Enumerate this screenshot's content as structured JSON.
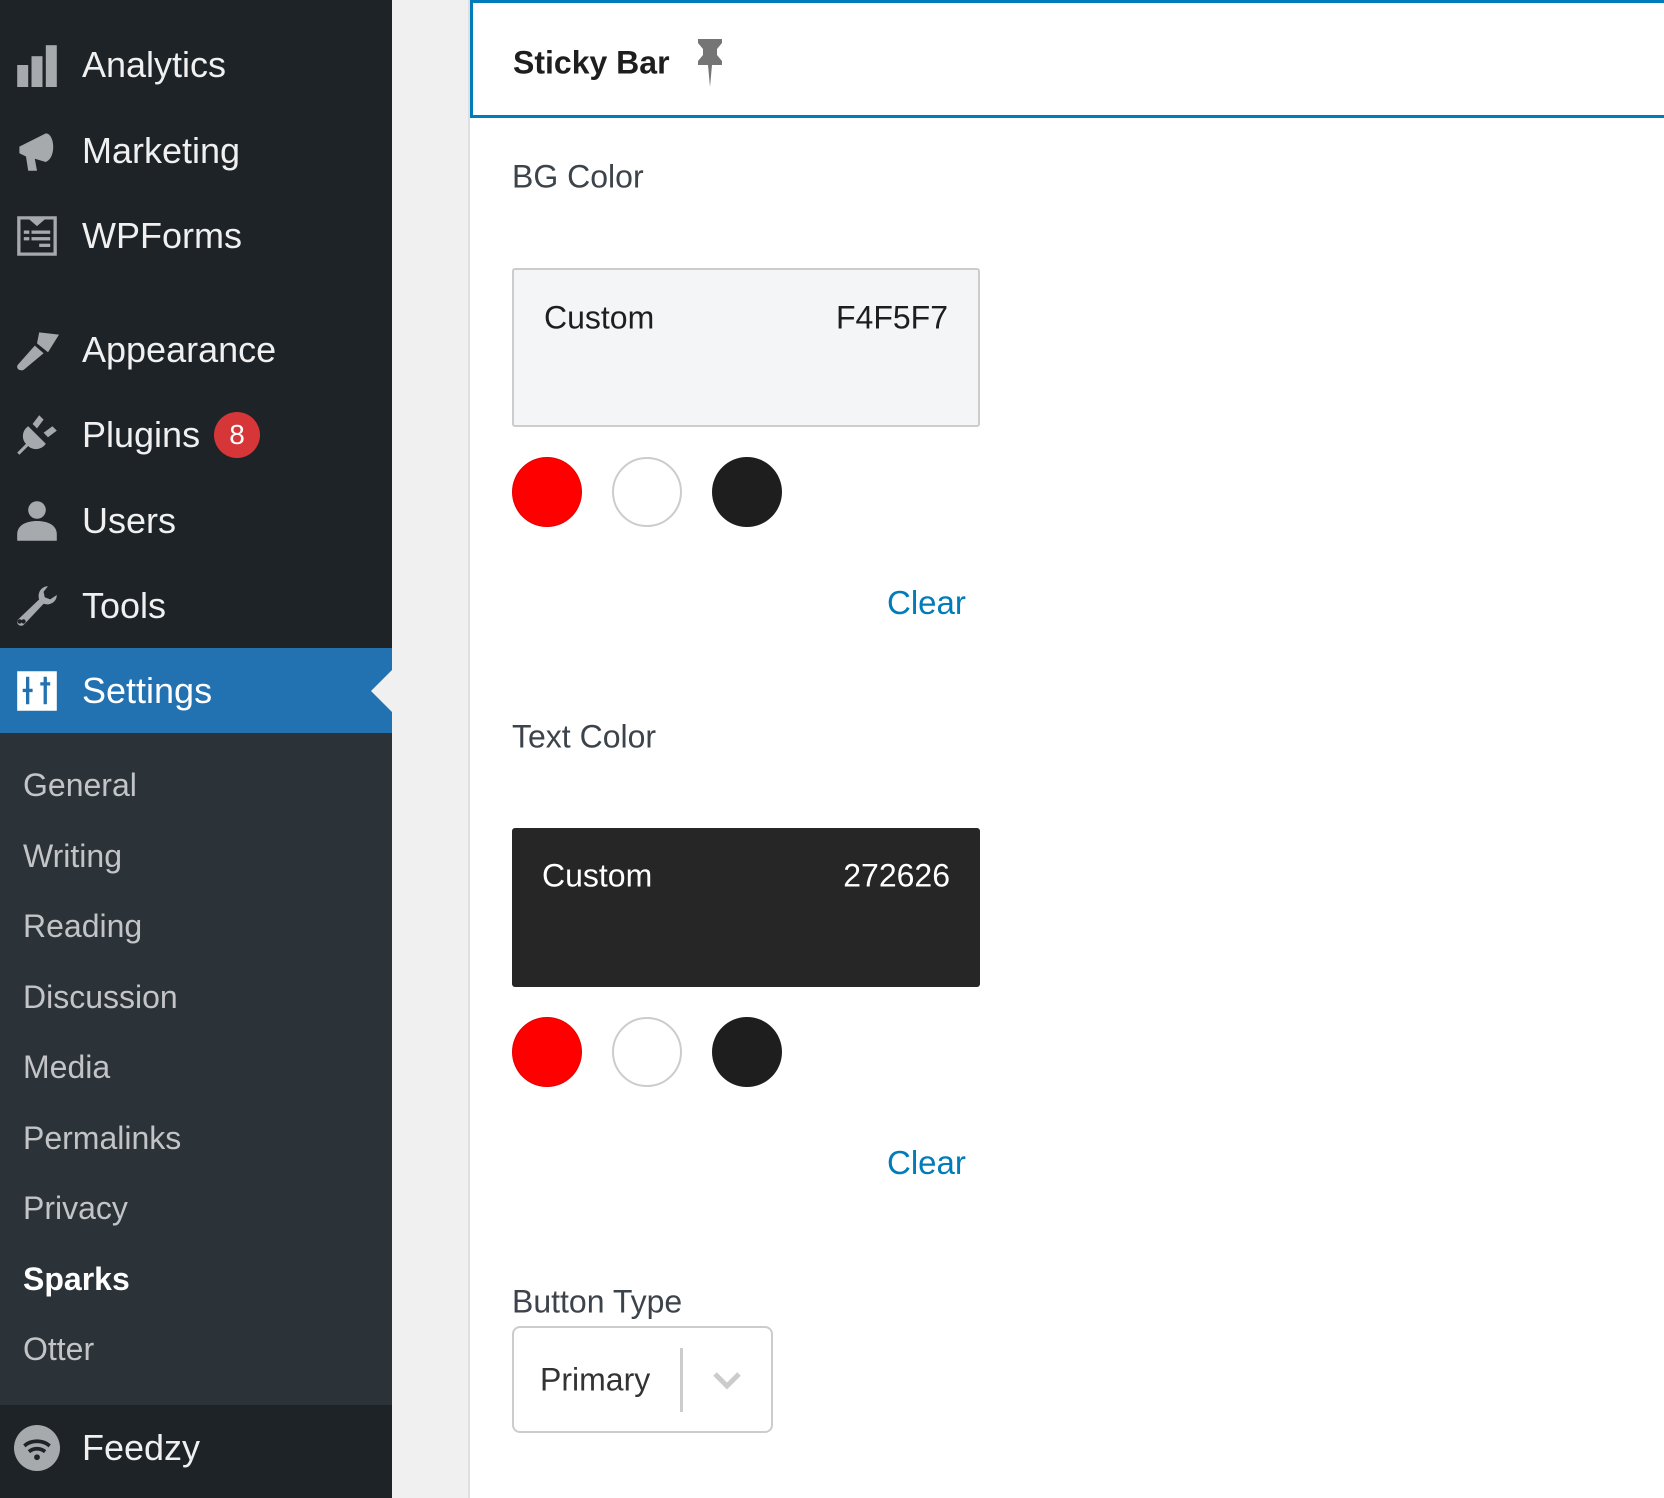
{
  "sidebar": {
    "items": [
      {
        "label": "Analytics",
        "icon": "analytics-bar-chart-icon"
      },
      {
        "label": "Marketing",
        "icon": "megaphone-icon"
      },
      {
        "label": "WPForms",
        "icon": "wpforms-icon"
      },
      {
        "label": "Appearance",
        "icon": "paintbrush-icon"
      },
      {
        "label": "Plugins",
        "icon": "plug-icon",
        "badge": "8"
      },
      {
        "label": "Users",
        "icon": "user-icon"
      },
      {
        "label": "Tools",
        "icon": "wrench-icon"
      }
    ],
    "active": {
      "label": "Settings",
      "icon": "settings-sliders-icon"
    },
    "submenu": [
      {
        "label": "General"
      },
      {
        "label": "Writing"
      },
      {
        "label": "Reading"
      },
      {
        "label": "Discussion"
      },
      {
        "label": "Media"
      },
      {
        "label": "Permalinks"
      },
      {
        "label": "Privacy"
      },
      {
        "label": "Sparks",
        "current": true
      },
      {
        "label": "Otter"
      }
    ],
    "after": {
      "label": "Feedzy",
      "icon": "feedzy-wifi-icon"
    }
  },
  "panel": {
    "title": "Sticky Bar",
    "pinned": true,
    "bg_color": {
      "label": "BG Color",
      "mode": "Custom",
      "hex": "F4F5F7",
      "swatches": [
        "#ff0000",
        "#ffffff",
        "#1e1e1e"
      ],
      "clear_label": "Clear"
    },
    "text_color": {
      "label": "Text Color",
      "mode": "Custom",
      "hex": "272626",
      "swatches": [
        "#ff0000",
        "#ffffff",
        "#1e1e1e"
      ],
      "clear_label": "Clear"
    },
    "button_type": {
      "label": "Button Type",
      "value": "Primary"
    }
  },
  "colors": {
    "sidebar_bg": "#1d2327",
    "submenu_bg": "#2c3338",
    "active_bg": "#2271b1",
    "badge": "#d63638",
    "accent": "#007cba"
  }
}
